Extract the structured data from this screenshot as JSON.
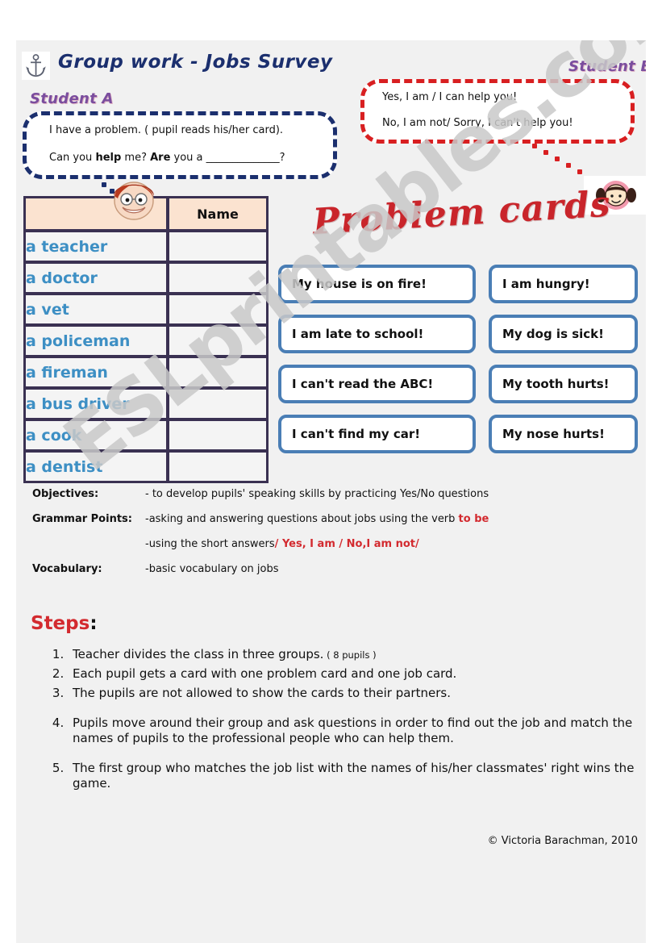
{
  "page": {
    "background": "#f1f1f1",
    "watermark": "ESLprintables.com"
  },
  "header": {
    "anchor_icon": "anchor-icon",
    "title": "Group work - Jobs Survey",
    "title_color": "#1b2f6e",
    "student_a_label": "Student A",
    "student_b_label": "Student B",
    "student_label_color": "#7a4d9e"
  },
  "bubbles": {
    "student_a": {
      "border_color": "#1b2f6e",
      "line1": "I have a problem. ( pupil reads his/her card).",
      "line2_prefix": "Can you ",
      "line2_bold1": "help",
      "line2_mid": " me? ",
      "line2_bold2": "Are",
      "line2_suffix": " you a ______________?"
    },
    "student_b": {
      "border_color": "#d81f21",
      "line1": "Yes, I am / I can help you!",
      "line2": "No, I am not/ Sorry, I can't help you!"
    }
  },
  "faces": {
    "boy": "boy-face-icon",
    "girl": "girl-face-icon"
  },
  "jobs_table": {
    "header_job": "",
    "header_name": "Name",
    "header_bg": "#fbe3d0",
    "job_text_color": "#3d8fc4",
    "rows": [
      "a teacher",
      "a doctor",
      "a vet",
      "a policeman",
      "a fireman",
      "a bus driver",
      "a cook",
      "a dentist"
    ]
  },
  "problem_cards": {
    "title": "Problem cards",
    "title_color": "#c9252b",
    "border_color": "#4a7eb5",
    "rows": [
      {
        "left": "My house is on fire!",
        "right": "I am hungry!"
      },
      {
        "left": "I am late to school!",
        "right": "My dog is sick!"
      },
      {
        "left": "I can't read the ABC!",
        "right": "My tooth hurts!"
      },
      {
        "left": "I can't find my car!",
        "right": "My nose hurts!"
      }
    ]
  },
  "info": {
    "objectives_label": "Objectives:",
    "objectives_value": "- to develop pupils' speaking skills by practicing Yes/No questions",
    "grammar_label": "Grammar Points:",
    "grammar_value_1_pre": "-asking and answering questions about jobs using the verb ",
    "grammar_value_1_red": "to be",
    "grammar_value_2_pre": "-using the short answers",
    "grammar_value_2_red": "/ Yes, I am / No,I am not/",
    "vocabulary_label": "Vocabulary:",
    "vocabulary_value": "-basic vocabulary on jobs",
    "red_color": "#d32a2f"
  },
  "steps": {
    "title": "Steps",
    "title_colon": ":",
    "title_color": "#d32a2f",
    "items": [
      {
        "text": "Teacher divides the class in three groups.",
        "note": " ( 8 pupils )"
      },
      {
        "text": "Each pupil gets a card with one problem card and one job card.",
        "note": ""
      },
      {
        "text": "The pupils are not allowed to show the cards to their partners.",
        "note": ""
      },
      {
        "text": "Pupils move around their group and ask questions in order to find out the job and match the names of pupils to the professional people who can help them.",
        "note": ""
      },
      {
        "text": "The first group who matches the job list with the names of his/her classmates' right wins the game.",
        "note": ""
      }
    ]
  },
  "footer": {
    "copyright": "© Victoria Barachman, 2010"
  }
}
